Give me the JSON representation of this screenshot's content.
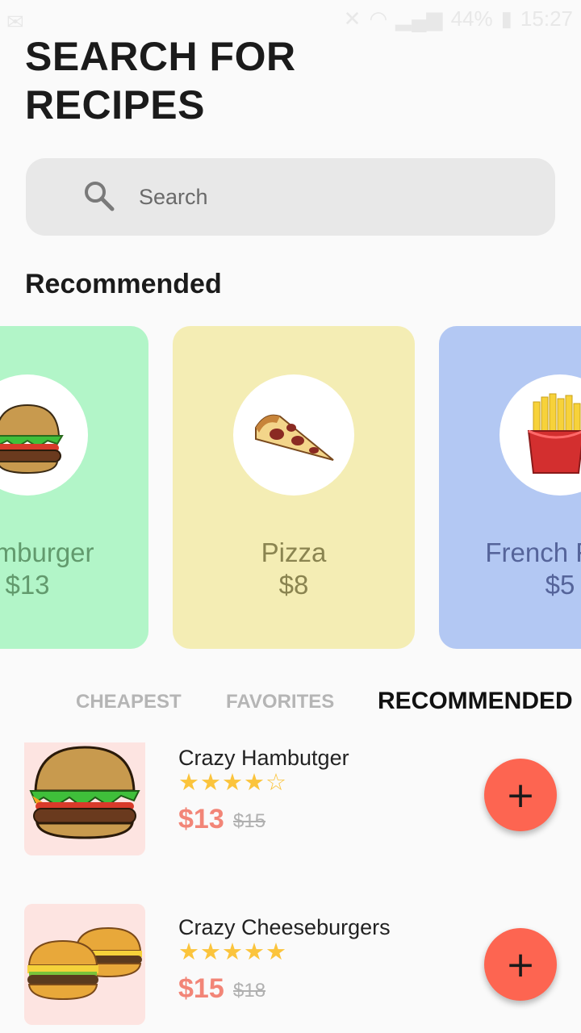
{
  "status_bar": {
    "battery": "44%",
    "time": "15:27"
  },
  "title": {
    "line1": "SEARCH FOR",
    "line2": "RECIPES"
  },
  "search": {
    "placeholder": "Search",
    "icon": "search-icon"
  },
  "recommended_heading": "Recommended",
  "cards": [
    {
      "name": "Hamburger",
      "price": "$13",
      "bg": "#b2f5c8",
      "text_color": "#629a6d",
      "icon": "hamburger-icon"
    },
    {
      "name": "Pizza",
      "price": "$8",
      "bg": "#f4edb4",
      "text_color": "#8a8450",
      "icon": "pizza-icon"
    },
    {
      "name": "French Fries",
      "price": "$5",
      "bg": "#b3c8f3",
      "text_color": "#55649a",
      "icon": "fries-icon"
    }
  ],
  "tabs": [
    {
      "label": "CHEAPEST",
      "active": false
    },
    {
      "label": "FAVORITES",
      "active": false
    },
    {
      "label": "RECOMMENDED",
      "active": true
    }
  ],
  "items": [
    {
      "name": "Crazy Hambutger",
      "rating": 4,
      "rating_max": 5,
      "price": "$13",
      "old_price": "$15",
      "icon": "hamburger-icon"
    },
    {
      "name": "Crazy Cheeseburgers",
      "rating": 5,
      "rating_max": 5,
      "price": "$15",
      "old_price": "$18",
      "icon": "cheeseburgers-icon"
    }
  ],
  "add_button_label": "+",
  "colors": {
    "accent": "#fd6551",
    "star": "#fbc43c",
    "price": "#f28577"
  }
}
